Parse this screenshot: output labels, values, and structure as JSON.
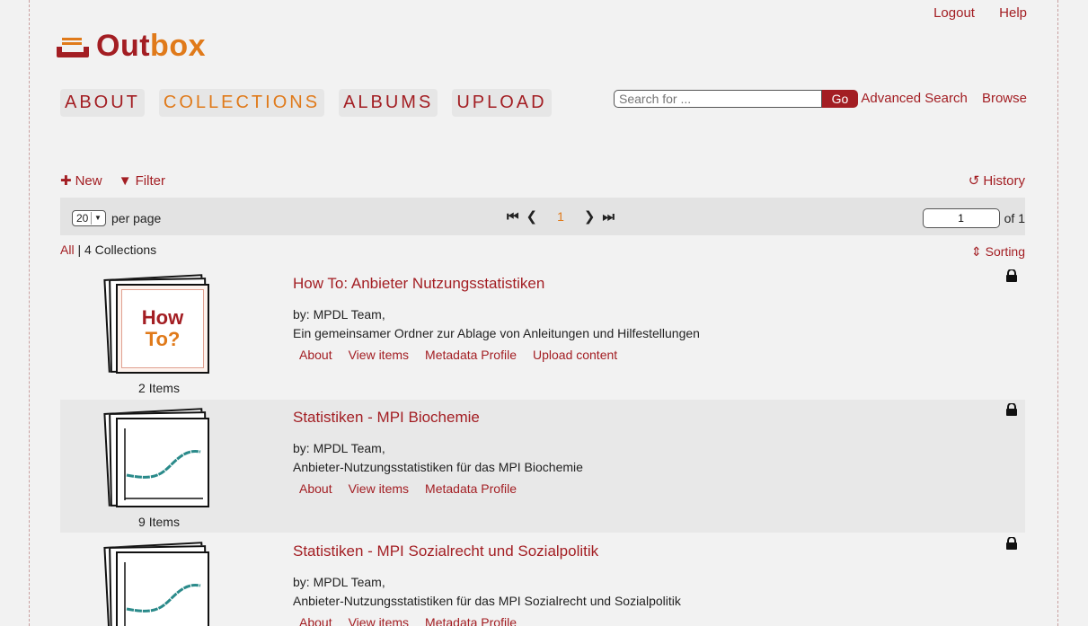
{
  "header": {
    "logout": "Logout",
    "help": "Help",
    "logo_part1": "Out",
    "logo_part2": "box",
    "nav": [
      "ABOUT",
      "COLLECTIONS",
      "ALBUMS",
      "UPLOAD"
    ],
    "search_placeholder": "Search for ...",
    "search_button": "Go",
    "advanced_search": "Advanced Search",
    "browse": "Browse"
  },
  "toolbar": {
    "new": "New",
    "filter": "Filter",
    "history": "History"
  },
  "pager": {
    "per_page_value": "20",
    "per_page_label": "per page",
    "current_page": "1",
    "jump_value": "1",
    "of_label": "of 1"
  },
  "summary": {
    "all": "All",
    "separator": "|",
    "count_label": "4 Collections",
    "sorting": "Sorting"
  },
  "collections": [
    {
      "title": "How To: Anbieter Nutzungsstatistiken",
      "by": "by: MPDL Team,",
      "description": "Ein gemeinsamer Ordner zur Ablage von Anleitungen und Hilfestellungen",
      "items": "2 Items",
      "thumb_text1": "How",
      "thumb_text2": "To?",
      "links": [
        "About",
        "View items",
        "Metadata Profile",
        "Upload content"
      ]
    },
    {
      "title": "Statistiken - MPI Biochemie",
      "by": "by: MPDL Team,",
      "description": "Anbieter-Nutzungsstatistiken für das MPI Biochemie",
      "items": "9 Items",
      "links": [
        "About",
        "View items",
        "Metadata Profile"
      ]
    },
    {
      "title": "Statistiken - MPI Sozialrecht und Sozialpolitik",
      "by": "by: MPDL Team,",
      "description": "Anbieter-Nutzungsstatistiken für das MPI Sozialrecht und Sozialpolitik",
      "links": [
        "About",
        "View items",
        "Metadata Profile"
      ]
    }
  ],
  "colors": {
    "brand_red": "#a31e23",
    "brand_orange": "#e07a1a"
  }
}
